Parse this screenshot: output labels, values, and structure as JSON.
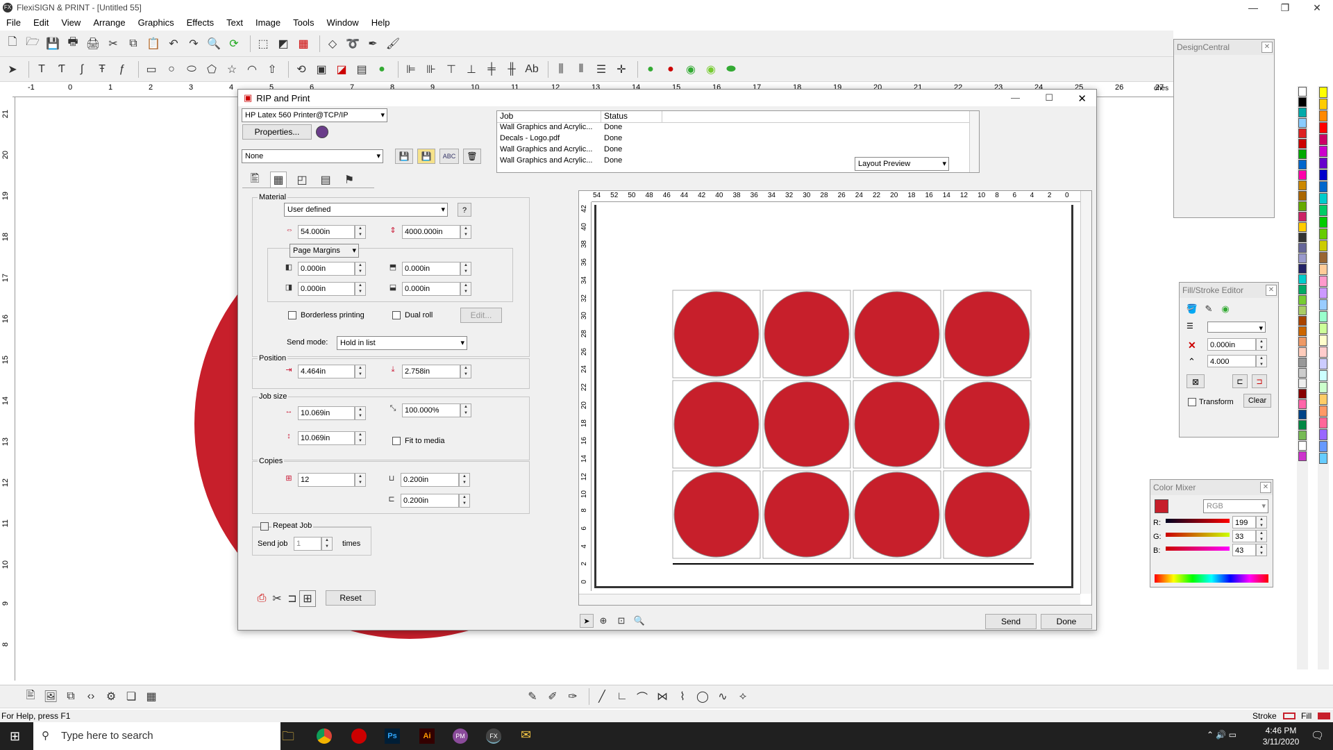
{
  "app": {
    "title": "FlexiSIGN & PRINT - [Untitled 55]"
  },
  "menu": [
    "File",
    "Edit",
    "View",
    "Arrange",
    "Graphics",
    "Effects",
    "Text",
    "Image",
    "Tools",
    "Window",
    "Help"
  ],
  "ruler": {
    "top": [
      "-1",
      "0",
      "1",
      "2",
      "3",
      "4",
      "5",
      "6",
      "7",
      "8",
      "9",
      "10",
      "11",
      "12",
      "13",
      "14",
      "15",
      "16",
      "17",
      "18",
      "19",
      "20",
      "21",
      "22",
      "23",
      "24",
      "25",
      "26",
      "27"
    ],
    "side": [
      "21",
      "20",
      "19",
      "18",
      "17",
      "16",
      "15",
      "14",
      "13",
      "12",
      "11",
      "10",
      "9",
      "8"
    ],
    "corner": "ches"
  },
  "dialog": {
    "title": "RIP and Print",
    "printer": "HP Latex 560 Printer@TCP/IP",
    "properties_label": "Properties...",
    "preset": "None",
    "abc_label": "ABC",
    "jobs_header": [
      "Job",
      "Status"
    ],
    "jobs": [
      {
        "job": "Wall Graphics and Acrylic...",
        "status": "Done"
      },
      {
        "job": "Decals - Logo.pdf",
        "status": "Done"
      },
      {
        "job": "Wall Graphics and Acrylic...",
        "status": "Done"
      },
      {
        "job": "Wall Graphics and Acrylic...",
        "status": "Done"
      }
    ],
    "preview_mode": "Layout Preview",
    "material": {
      "label": "Material",
      "type": "User defined",
      "width": "54.000in",
      "length": "4000.000in",
      "margins_label": "Page Margins",
      "m_left": "0.000in",
      "m_top": "0.000in",
      "m_right": "0.000in",
      "m_bottom": "0.000in",
      "borderless": "Borderless printing",
      "dual_roll": "Dual roll",
      "edit": "Edit..."
    },
    "send_mode_label": "Send mode:",
    "send_mode": "Hold in list",
    "position": {
      "label": "Position",
      "x": "4.464in",
      "y": "2.758in"
    },
    "job_size": {
      "label": "Job size",
      "w": "10.069in",
      "h": "10.069in",
      "scale": "100.000%",
      "fit": "Fit to media"
    },
    "copies": {
      "label": "Copies",
      "count": "12",
      "h_gap": "0.200in",
      "v_gap": "0.200in"
    },
    "repeat": {
      "label": "Repeat Job",
      "send_job": "Send job",
      "times_value": "1",
      "times": "times"
    },
    "reset": "Reset",
    "send": "Send",
    "done": "Done",
    "preview_ruler_top": [
      "54",
      "52",
      "50",
      "48",
      "46",
      "44",
      "42",
      "40",
      "38",
      "36",
      "34",
      "32",
      "30",
      "28",
      "26",
      "24",
      "22",
      "20",
      "18",
      "16",
      "14",
      "12",
      "10",
      "8",
      "6",
      "4",
      "2",
      "0"
    ],
    "preview_ruler_side": [
      "42",
      "40",
      "38",
      "36",
      "34",
      "32",
      "30",
      "28",
      "26",
      "24",
      "22",
      "20",
      "18",
      "16",
      "14",
      "12",
      "10",
      "8",
      "6",
      "4",
      "2",
      "0"
    ],
    "circle_color": "#c71f2b",
    "grid": {
      "cols": 4,
      "rows": 3
    }
  },
  "panels": {
    "design_central": "DesignCentral",
    "fill_stroke": {
      "title": "Fill/Stroke Editor",
      "width": "0.000in",
      "miter": "4.000",
      "transform": "Transform",
      "clear": "Clear"
    },
    "color_mixer": {
      "title": "Color Mixer",
      "mode": "RGB",
      "r_label": "R:",
      "g_label": "G:",
      "b_label": "B:",
      "r": "199",
      "g": "33",
      "b": "43"
    }
  },
  "status": {
    "help": "For Help, press F1",
    "stroke": "Stroke",
    "fill": "Fill"
  },
  "taskbar": {
    "search": "Type here to search",
    "time": "4:46 PM",
    "date": "3/11/2020",
    "apps": [
      "Ps",
      "Ai",
      "PM",
      "FX"
    ]
  }
}
